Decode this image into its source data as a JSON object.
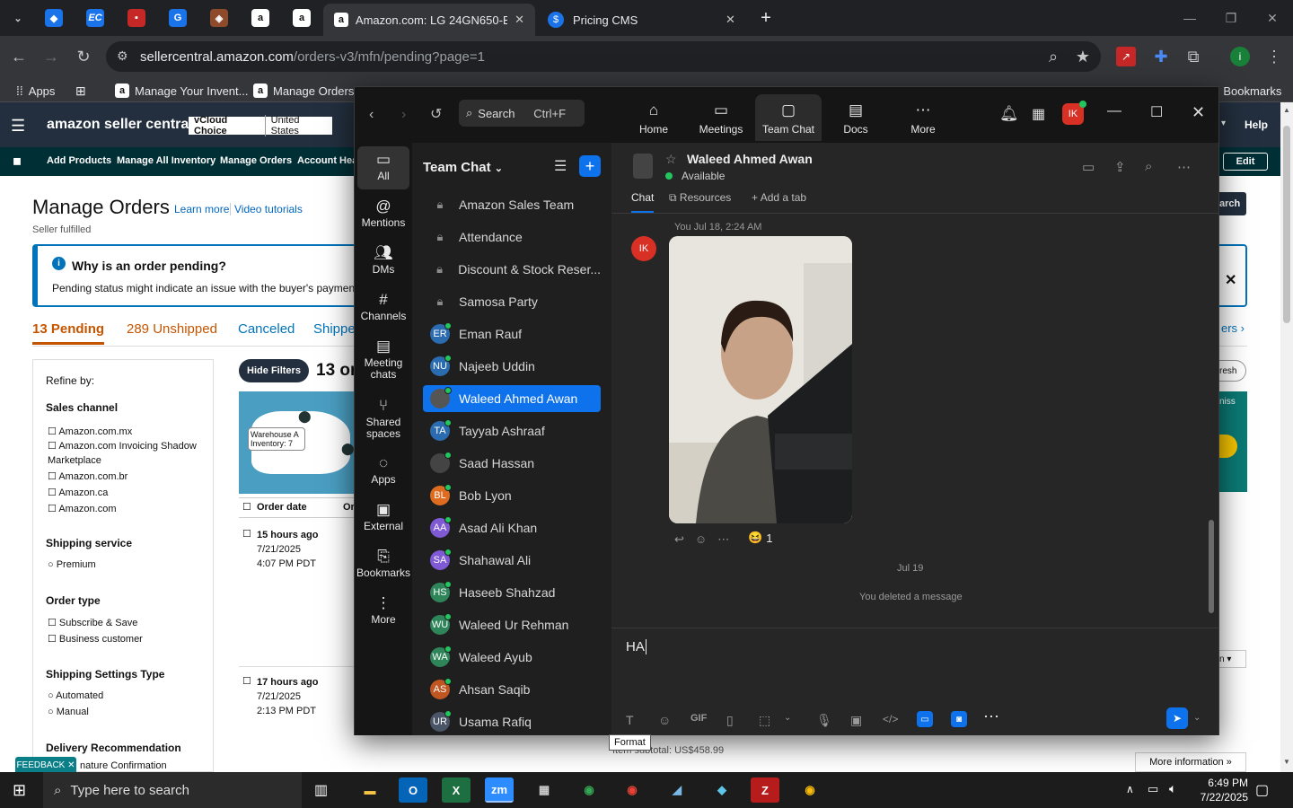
{
  "browser": {
    "active_tab_title": "Amazon.com: LG 24GN650-B U",
    "second_tab_title": "Pricing CMS",
    "url_host": "sellercentral.amazon.com",
    "url_path": "/orders-v3/mfn/pending?page=1",
    "bookmarks": [
      "Apps",
      "Manage Your Invent...",
      "Manage Orders",
      "All Bookmarks"
    ],
    "pinned_tab_labels": [
      "EC"
    ]
  },
  "amazon": {
    "logo": "amazon seller central",
    "vcloud": "vCloud Choice",
    "marketplace": "United States",
    "help": "Help",
    "edit": "Edit",
    "nav": [
      "Add Products",
      "Manage All Inventory",
      "Manage Orders",
      "Account Heal"
    ],
    "page_title": "Manage Orders",
    "learn_more": "Learn more",
    "video_tutorials": "Video tutorials",
    "fulfilled": "Seller fulfilled",
    "info_title": "Why is an order pending?",
    "info_body": "Pending status might indicate an issue with the buyer's payment m",
    "tabs": [
      "13 Pending",
      "289 Unshipped",
      "Canceled",
      "Shippe"
    ],
    "refine": "Refine by:",
    "sales_channel_title": "Sales channel",
    "sales_channels": [
      "Amazon.com.mx",
      "Amazon.com Invoicing Shadow Marketplace",
      "Amazon.com.br",
      "Amazon.ca",
      "Amazon.com"
    ],
    "shipping_service_title": "Shipping service",
    "shipping_service": "Premium",
    "order_type_title": "Order type",
    "order_types": [
      "Subscribe & Save",
      "Business customer"
    ],
    "shipping_settings_title": "Shipping Settings Type",
    "shipping_settings": [
      "Automated",
      "Manual"
    ],
    "delivery_title": "Delivery Recommendation",
    "delivery_partial": "nature Confirmation",
    "hide_filters": "Hide Filters",
    "orders_count": "13 or",
    "map_label": "Warehouse A Inventory: 7",
    "order_date_header": "Order date",
    "order_col2": "Or",
    "orders": [
      {
        "ago": "15 hours ago",
        "date": "7/21/2025",
        "time": "4:07 PM PDT"
      },
      {
        "ago": "17 hours ago",
        "date": "7/21/2025",
        "time": "2:13 PM PDT"
      }
    ],
    "item_subtotal": "Item subtotal: US$458.99",
    "more_information": "More information »",
    "feedback": "FEEDBACK",
    "right_partial": [
      "arch",
      "ers ›",
      "resh",
      "niss",
      "n ▾"
    ]
  },
  "zoom": {
    "search_placeholder": "Search",
    "search_shortcut": "Ctrl+F",
    "top_tabs": [
      "Home",
      "Meetings",
      "Team Chat",
      "Docs",
      "More"
    ],
    "user_initials": "IK",
    "rail": [
      {
        "label": "All",
        "icon": "chat-bubble-icon"
      },
      {
        "label": "Mentions",
        "icon": "at-icon"
      },
      {
        "label": "DMs",
        "icon": "people-icon"
      },
      {
        "label": "Channels",
        "icon": "hash-icon"
      },
      {
        "label": "Meeting chats",
        "icon": "calendar-icon"
      },
      {
        "label": "Shared spaces",
        "icon": "share-icon"
      },
      {
        "label": "Apps",
        "icon": "apps-icon"
      },
      {
        "label": "External",
        "icon": "external-icon"
      },
      {
        "label": "Bookmarks",
        "icon": "bookmark-icon"
      },
      {
        "label": "More",
        "icon": "more-icon"
      }
    ],
    "list_title": "Team Chat",
    "channels": [
      {
        "name": "Amazon Sales Team",
        "type": "lock"
      },
      {
        "name": "Attendance",
        "type": "lock"
      },
      {
        "name": "Discount & Stock Reser...",
        "type": "lock"
      },
      {
        "name": "Samosa Party",
        "type": "lock"
      },
      {
        "name": "Eman Rauf",
        "initials": "ER",
        "color": "#2b6cb0"
      },
      {
        "name": "Najeeb Uddin",
        "initials": "NU",
        "color": "#2b6cb0"
      },
      {
        "name": "Waleed Ahmed Awan",
        "initials": "",
        "color": "#555555",
        "active": true
      },
      {
        "name": "Tayyab Ashraaf",
        "initials": "TA",
        "color": "#2b6cb0"
      },
      {
        "name": "Saad Hassan",
        "initials": "",
        "color": "#444444"
      },
      {
        "name": "Bob Lyon",
        "initials": "BL",
        "color": "#dd6b20"
      },
      {
        "name": "Asad Ali Khan",
        "initials": "AA",
        "color": "#805ad5"
      },
      {
        "name": "Shahawal Ali",
        "initials": "SA",
        "color": "#805ad5"
      },
      {
        "name": "Haseeb Shahzad",
        "initials": "HS",
        "color": "#2f855a"
      },
      {
        "name": "Waleed Ur Rehman",
        "initials": "WU",
        "color": "#2f855a"
      },
      {
        "name": "Waleed Ayub",
        "initials": "WA",
        "color": "#2f855a"
      },
      {
        "name": "Ahsan Saqib",
        "initials": "AS",
        "color": "#c05621"
      },
      {
        "name": "Usama Rafiq",
        "initials": "UR",
        "color": "#4a5568"
      }
    ],
    "contact_name": "Waleed Ahmed Awan",
    "contact_status": "Available",
    "chat_tabs": [
      "Chat",
      "Resources",
      "Add a tab"
    ],
    "message_meta": "You Jul 18, 2:24 AM",
    "sender_initials": "IK",
    "reaction_count": "1",
    "date_divider": "Jul 19",
    "deleted_note": "You deleted a message",
    "composer_text": "HA",
    "tooltip": "Format",
    "gif_label": "GIF"
  },
  "taskbar": {
    "search_placeholder": "Type here to search",
    "time": "6:49 PM",
    "date": "7/22/2025",
    "apps": [
      "zm"
    ]
  }
}
